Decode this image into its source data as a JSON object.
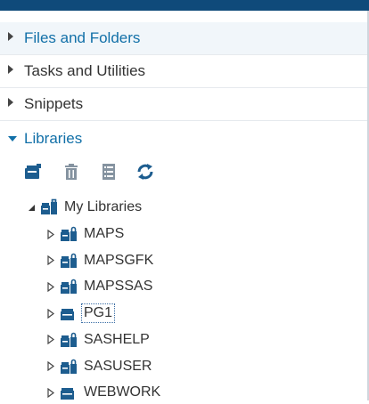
{
  "sections": [
    {
      "id": "files",
      "label": "Files and Folders",
      "state": "active"
    },
    {
      "id": "tasks",
      "label": "Tasks and Utilities",
      "state": "collapsed"
    },
    {
      "id": "snippets",
      "label": "Snippets",
      "state": "collapsed"
    },
    {
      "id": "libraries",
      "label": "Libraries",
      "state": "expanded"
    }
  ],
  "toolbar": {
    "icons": [
      "new-library-icon",
      "delete-icon",
      "properties-icon",
      "refresh-icon"
    ]
  },
  "tree": {
    "root": {
      "label": "My Libraries",
      "icon": "library-group-icon"
    },
    "items": [
      {
        "label": "MAPS",
        "icon": "library-lock-icon"
      },
      {
        "label": "MAPSGFK",
        "icon": "library-lock-icon"
      },
      {
        "label": "MAPSSAS",
        "icon": "library-lock-icon"
      },
      {
        "label": "PG1",
        "icon": "library-icon",
        "selected": true
      },
      {
        "label": "SASHELP",
        "icon": "library-lock-icon"
      },
      {
        "label": "SASUSER",
        "icon": "library-lock-icon"
      },
      {
        "label": "WEBWORK",
        "icon": "library-icon"
      }
    ]
  },
  "colors": {
    "accent": "#1270a8",
    "icon": "#1d5d8f",
    "topbar": "#0f4a7a"
  }
}
